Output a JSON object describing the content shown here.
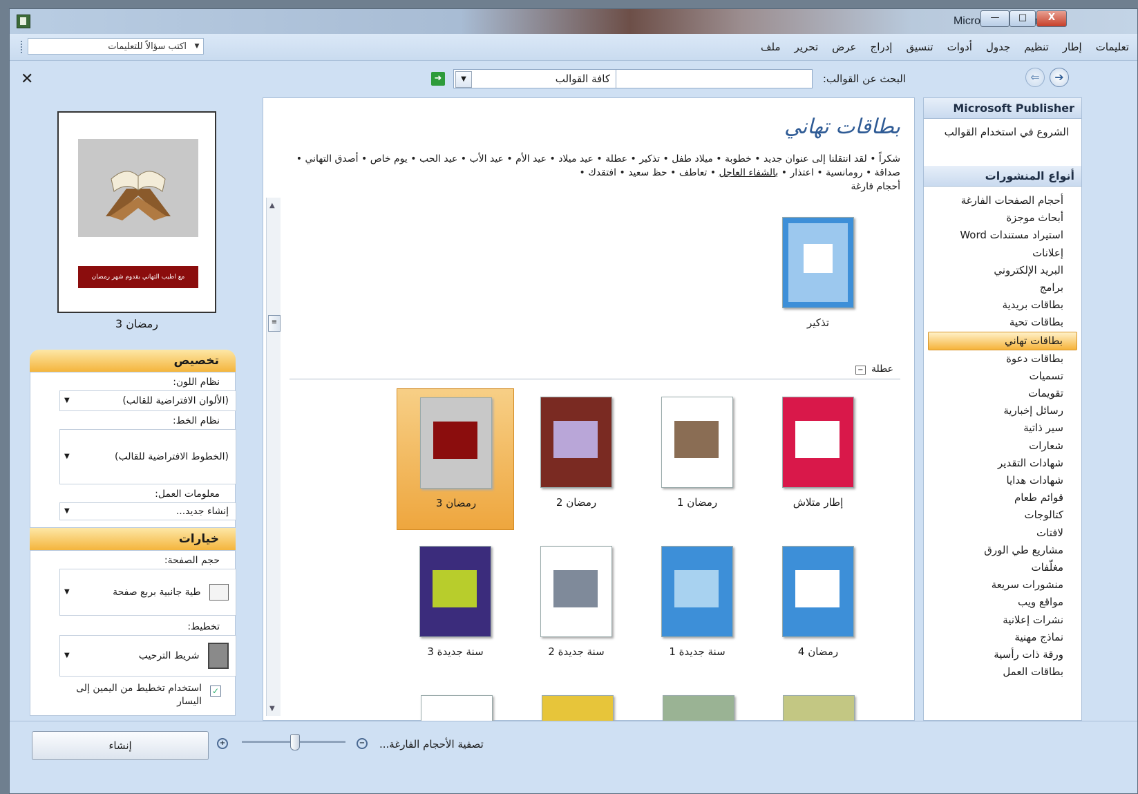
{
  "window": {
    "title": "Microsoft Publisher",
    "min": "—",
    "max": "□",
    "close": "X"
  },
  "menu": [
    "ملف",
    "تحرير",
    "عرض",
    "إدراج",
    "تنسيق",
    "أدوات",
    "جدول",
    "تنظيم",
    "إطار",
    "تعليمات"
  ],
  "ask": {
    "placeholder": "اكتب سؤالاً للتعليمات"
  },
  "search": {
    "label": "البحث عن القوالب:",
    "scope": "كافة القوالب"
  },
  "left": {
    "preview_name": "رمضان 3",
    "preview_banner": "مع اطيب التهاني بقدوم شهر رمضان",
    "customize_title": "تخصيص",
    "color_label": "نظام اللون:",
    "color_value": "(الألوان الافتراضية للقالب)",
    "font_label": "نظام الخط:",
    "font_value": "(الخطوط الافتراضية للقالب)",
    "business_label": "معلومات العمل:",
    "business_value": "إنشاء جديد...",
    "options_title": "خيارات",
    "pagesize_label": "حجم الصفحة:",
    "pagesize_value": "طية جانبية بربع صفحة",
    "layout_label": "تخطيط:",
    "layout_value": "شريط الترحيب",
    "rtl_label": "استخدام تخطيط من اليمين إلى اليسار",
    "rtl_checked": true
  },
  "center": {
    "title": "بطاقات تهاني",
    "links": [
      {
        "t": "شكراً"
      },
      {
        "t": "لقد انتقلنا إلى عنوان جديد"
      },
      {
        "t": "خطوبة"
      },
      {
        "t": "ميلاد طفل"
      },
      {
        "t": "تذكير"
      },
      {
        "t": "عطلة"
      },
      {
        "t": "عيد ميلاد"
      },
      {
        "t": "عيد الأم"
      },
      {
        "t": "عيد الأب"
      },
      {
        "t": "عيد الحب"
      },
      {
        "t": "يوم خاص"
      },
      {
        "t": "أصدق التهاني"
      },
      {
        "t": "صداقة"
      },
      {
        "t": "رومانسية"
      },
      {
        "t": "اعتذار"
      },
      {
        "t": "بالشفاء العاجل",
        "u": true
      },
      {
        "t": "تعاطف"
      },
      {
        "t": "حظ سعيد"
      },
      {
        "t": "افتقدك"
      },
      {
        "t": "أحجام فارغة"
      }
    ],
    "top_item": "تذكير",
    "group_label": "عطلة",
    "row1": [
      "إطار متلاش",
      "رمضان 1",
      "رمضان 2",
      "رمضان 3"
    ],
    "row2": [
      "رمضان 4",
      "سنة جديدة 1",
      "سنة جديدة 2",
      "سنة جديدة 3"
    ]
  },
  "right": {
    "head1": "Microsoft Publisher",
    "getting_started": "الشروع في استخدام القوالب",
    "head2": "أنواع المنشورات",
    "items": [
      "أحجام الصفحات الفارغة",
      "أبحاث موجزة",
      "استيراد مستندات Word",
      "إعلانات",
      "البريد الإلكتروني",
      "برامج",
      "بطاقات بريدية",
      "بطاقات تحية",
      "بطاقات تهاني",
      "بطاقات دعوة",
      "تسميات",
      "تقويمات",
      "رسائل إخبارية",
      "سير ذاتية",
      "شعارات",
      "شهادات التقدير",
      "شهادات هدايا",
      "قوائم طعام",
      "كتالوجات",
      "لافتات",
      "مشاريع طي الورق",
      "مغلّفات",
      "منشورات سريعة",
      "مواقع ويب",
      "نشرات إعلانية",
      "نماذج مهنية",
      "ورقة ذات رأسية",
      "بطاقات العمل"
    ],
    "active_index": 8
  },
  "bottom": {
    "create": "إنشاء",
    "filter": "تصفية الأحجام الفارغة..."
  },
  "colors": {
    "accent": "#f4b53d",
    "title_blue": "#2f5b95",
    "banner_red": "#8b0d0d"
  }
}
